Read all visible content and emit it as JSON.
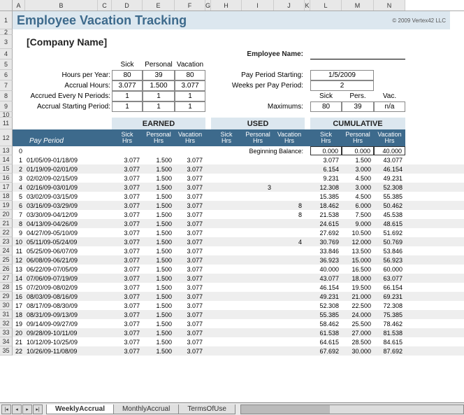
{
  "title": "Employee Vacation Tracking",
  "copyright": "© 2009 Vertex42 LLC",
  "company": "[Company Name]",
  "employee_name_label": "Employee Name:",
  "accrual": {
    "cols": [
      "Sick",
      "Personal",
      "Vacation"
    ],
    "rows": [
      {
        "label": "Hours per Year:",
        "vals": [
          "80",
          "39",
          "80"
        ]
      },
      {
        "label": "Accrual Hours:",
        "vals": [
          "3.077",
          "1.500",
          "3.077"
        ]
      },
      {
        "label": "Accrued Every N Periods:",
        "vals": [
          "1",
          "1",
          "1"
        ]
      },
      {
        "label": "Accrual Starting Period:",
        "vals": [
          "1",
          "1",
          "1"
        ]
      }
    ]
  },
  "pay_settings": {
    "start_label": "Pay Period Starting:",
    "start_value": "1/5/2009",
    "weeks_label": "Weeks per Pay Period:",
    "weeks_value": "2",
    "max_label": "Maximums:",
    "max_cols": [
      "Sick",
      "Pers.",
      "Vac."
    ],
    "max_vals": [
      "80",
      "39",
      "n/a"
    ]
  },
  "groups": {
    "earned": "EARNED",
    "used": "USED",
    "cumulative": "CUMULATIVE"
  },
  "col_sub": [
    "Sick",
    "Personal",
    "Vacation"
  ],
  "col_sub2": "Hrs",
  "pay_period_label": "Pay Period",
  "begin_bal_label": "Beginning Balance:",
  "begin_bal": [
    "0.000",
    "0.000",
    "40.000"
  ],
  "rows": [
    {
      "i": "1",
      "p": "01/05/09-01/18/09",
      "e": [
        "3.077",
        "1.500",
        "3.077"
      ],
      "u": [
        "",
        "",
        ""
      ],
      "c": [
        "3.077",
        "1.500",
        "43.077"
      ]
    },
    {
      "i": "2",
      "p": "01/19/09-02/01/09",
      "e": [
        "3.077",
        "1.500",
        "3.077"
      ],
      "u": [
        "",
        "",
        ""
      ],
      "c": [
        "6.154",
        "3.000",
        "46.154"
      ]
    },
    {
      "i": "3",
      "p": "02/02/09-02/15/09",
      "e": [
        "3.077",
        "1.500",
        "3.077"
      ],
      "u": [
        "",
        "",
        ""
      ],
      "c": [
        "9.231",
        "4.500",
        "49.231"
      ]
    },
    {
      "i": "4",
      "p": "02/16/09-03/01/09",
      "e": [
        "3.077",
        "1.500",
        "3.077"
      ],
      "u": [
        "",
        "3",
        ""
      ],
      "c": [
        "12.308",
        "3.000",
        "52.308"
      ]
    },
    {
      "i": "5",
      "p": "03/02/09-03/15/09",
      "e": [
        "3.077",
        "1.500",
        "3.077"
      ],
      "u": [
        "",
        "",
        ""
      ],
      "c": [
        "15.385",
        "4.500",
        "55.385"
      ]
    },
    {
      "i": "6",
      "p": "03/16/09-03/29/09",
      "e": [
        "3.077",
        "1.500",
        "3.077"
      ],
      "u": [
        "",
        "",
        "8"
      ],
      "c": [
        "18.462",
        "6.000",
        "50.462"
      ]
    },
    {
      "i": "7",
      "p": "03/30/09-04/12/09",
      "e": [
        "3.077",
        "1.500",
        "3.077"
      ],
      "u": [
        "",
        "",
        "8"
      ],
      "c": [
        "21.538",
        "7.500",
        "45.538"
      ]
    },
    {
      "i": "8",
      "p": "04/13/09-04/26/09",
      "e": [
        "3.077",
        "1.500",
        "3.077"
      ],
      "u": [
        "",
        "",
        ""
      ],
      "c": [
        "24.615",
        "9.000",
        "48.615"
      ]
    },
    {
      "i": "9",
      "p": "04/27/09-05/10/09",
      "e": [
        "3.077",
        "1.500",
        "3.077"
      ],
      "u": [
        "",
        "",
        ""
      ],
      "c": [
        "27.692",
        "10.500",
        "51.692"
      ]
    },
    {
      "i": "10",
      "p": "05/11/09-05/24/09",
      "e": [
        "3.077",
        "1.500",
        "3.077"
      ],
      "u": [
        "",
        "",
        "4"
      ],
      "c": [
        "30.769",
        "12.000",
        "50.769"
      ]
    },
    {
      "i": "11",
      "p": "05/25/09-06/07/09",
      "e": [
        "3.077",
        "1.500",
        "3.077"
      ],
      "u": [
        "",
        "",
        ""
      ],
      "c": [
        "33.846",
        "13.500",
        "53.846"
      ]
    },
    {
      "i": "12",
      "p": "06/08/09-06/21/09",
      "e": [
        "3.077",
        "1.500",
        "3.077"
      ],
      "u": [
        "",
        "",
        ""
      ],
      "c": [
        "36.923",
        "15.000",
        "56.923"
      ]
    },
    {
      "i": "13",
      "p": "06/22/09-07/05/09",
      "e": [
        "3.077",
        "1.500",
        "3.077"
      ],
      "u": [
        "",
        "",
        ""
      ],
      "c": [
        "40.000",
        "16.500",
        "60.000"
      ]
    },
    {
      "i": "14",
      "p": "07/06/09-07/19/09",
      "e": [
        "3.077",
        "1.500",
        "3.077"
      ],
      "u": [
        "",
        "",
        ""
      ],
      "c": [
        "43.077",
        "18.000",
        "63.077"
      ]
    },
    {
      "i": "15",
      "p": "07/20/09-08/02/09",
      "e": [
        "3.077",
        "1.500",
        "3.077"
      ],
      "u": [
        "",
        "",
        ""
      ],
      "c": [
        "46.154",
        "19.500",
        "66.154"
      ]
    },
    {
      "i": "16",
      "p": "08/03/09-08/16/09",
      "e": [
        "3.077",
        "1.500",
        "3.077"
      ],
      "u": [
        "",
        "",
        ""
      ],
      "c": [
        "49.231",
        "21.000",
        "69.231"
      ]
    },
    {
      "i": "17",
      "p": "08/17/09-08/30/09",
      "e": [
        "3.077",
        "1.500",
        "3.077"
      ],
      "u": [
        "",
        "",
        ""
      ],
      "c": [
        "52.308",
        "22.500",
        "72.308"
      ]
    },
    {
      "i": "18",
      "p": "08/31/09-09/13/09",
      "e": [
        "3.077",
        "1.500",
        "3.077"
      ],
      "u": [
        "",
        "",
        ""
      ],
      "c": [
        "55.385",
        "24.000",
        "75.385"
      ]
    },
    {
      "i": "19",
      "p": "09/14/09-09/27/09",
      "e": [
        "3.077",
        "1.500",
        "3.077"
      ],
      "u": [
        "",
        "",
        ""
      ],
      "c": [
        "58.462",
        "25.500",
        "78.462"
      ]
    },
    {
      "i": "20",
      "p": "09/28/09-10/11/09",
      "e": [
        "3.077",
        "1.500",
        "3.077"
      ],
      "u": [
        "",
        "",
        ""
      ],
      "c": [
        "61.538",
        "27.000",
        "81.538"
      ]
    },
    {
      "i": "21",
      "p": "10/12/09-10/25/09",
      "e": [
        "3.077",
        "1.500",
        "3.077"
      ],
      "u": [
        "",
        "",
        ""
      ],
      "c": [
        "64.615",
        "28.500",
        "84.615"
      ]
    },
    {
      "i": "22",
      "p": "10/26/09-11/08/09",
      "e": [
        "3.077",
        "1.500",
        "3.077"
      ],
      "u": [
        "",
        "",
        ""
      ],
      "c": [
        "67.692",
        "30.000",
        "87.692"
      ]
    }
  ],
  "col_letters": [
    "A",
    "B",
    "C",
    "D",
    "E",
    "F",
    "G",
    "H",
    "I",
    "J",
    "K",
    "L",
    "M",
    "N"
  ],
  "col_widths": [
    "cA",
    "cB",
    "cC",
    "cD",
    "cE",
    "cF",
    "cG",
    "cH",
    "cI",
    "cJ",
    "cK",
    "cL",
    "cM",
    "cN",
    "cO"
  ],
  "tabs": [
    "WeeklyAccrual",
    "MonthlyAccrual",
    "TermsOfUse"
  ]
}
